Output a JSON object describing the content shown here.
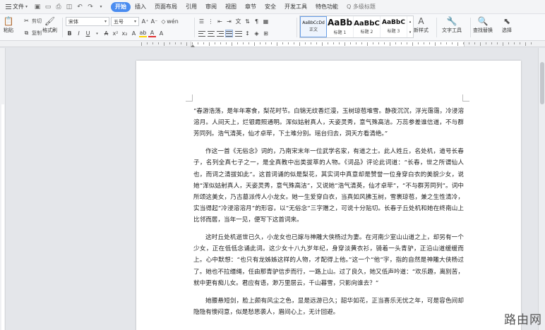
{
  "menubar": {
    "file_label": "文件",
    "tabs": [
      "开始",
      "插入",
      "页面布局",
      "引用",
      "审阅",
      "视图",
      "章节",
      "安全",
      "开发工具",
      "特色功能"
    ],
    "active_tab": "开始",
    "search_label": "Q 多级标题"
  },
  "ribbon": {
    "paste": "粘贴",
    "cut": "剪切",
    "copy": "复制",
    "format_painter": "格式刷",
    "font_name": "宋体",
    "font_size": "五号",
    "styles": [
      {
        "sample": "AaBbCcDd",
        "name": "正文"
      },
      {
        "sample": "AaBb",
        "name": "标题 1"
      },
      {
        "sample": "AaBbC",
        "name": "标题 2"
      },
      {
        "sample": "AaBbC",
        "name": "标题 3"
      }
    ],
    "new_style": "新样式",
    "text_tools": "文字工具",
    "find_replace": "查找替换",
    "select": "选择"
  },
  "document": {
    "paragraphs": [
      "“春游浩荡，是年年寒食，梨花时节。白锦无纹香烂漫，玉树琼苞堆雪。静夜沉沉，浮光霭霭，冷浸溶溶月。人间天上，烂银霞照通明。浑似姑射真人，天姿灵秀，意气殊高洁。万蕊参差谁信道，不与群芳同列。浩气清英，仙才卓荦，下土难分别。瑶台归去，洞天方看清绝。”",
      "作这一首《无俗念》词的，乃南宋末年一位武学名家，有道之士。此人姓丘，名处机，道号长春子，名列全真七子之一，是全真教中出类拔萃的人物。《词品》评论此词道：“长春，世之所谓仙人也，而词之清拔如此”。这首词诵的似是梨花，其实词中真意却是赞誉一位身穿白衣的美貌少女，说她“浑似姑射真人，天姿灵秀，意气殊高洁”，又说她“浩气清英，仙才卓荦”，“不与群芳同列”。词中所颂这美女，乃古墓派传人小龙女。她一生爱穿白衣，当真如风拂玉树，雪裹琼苞，兼之生性清冷，实当得起“冷浸溶溶月”的形容，以“无俗念”三字赠之，可说十分贴切。长春子丘处机和她在终南山上比邻而居，当年一见，便写下这首词来。",
      "这时丘处机逝世已久，小龙女也已嫁与神雕大侠杨过为妻。在河南少室山山道之上，却另有一个少女，正在低低念诵此词。这少女十八九岁年纪，身穿淡黄衣衫，骑着一头青驴，正沿山道缓缓而上。心中默想：“也只有龙姊姊这样的人物，才配得上他。”这一个“他”字，指的自然是神雕大侠杨过了。她也不拉缰绳，任由那青驴信步而行，一路上山。过了良久，她又低声吟道：“欢乐趣，离别苦，就中更有痴儿女。君应有语，渺万里层云，千山暮雪，只影向谁去？”",
      "她腰悬短剑，脸上颇有风尘之色，显是远游已久；韶华如花，正当喜乐无忧之年，可是容色间却隐隐有懊闷意，似是愁思袭人，眉间心上，无计回避。"
    ]
  },
  "watermark": "路由网"
}
